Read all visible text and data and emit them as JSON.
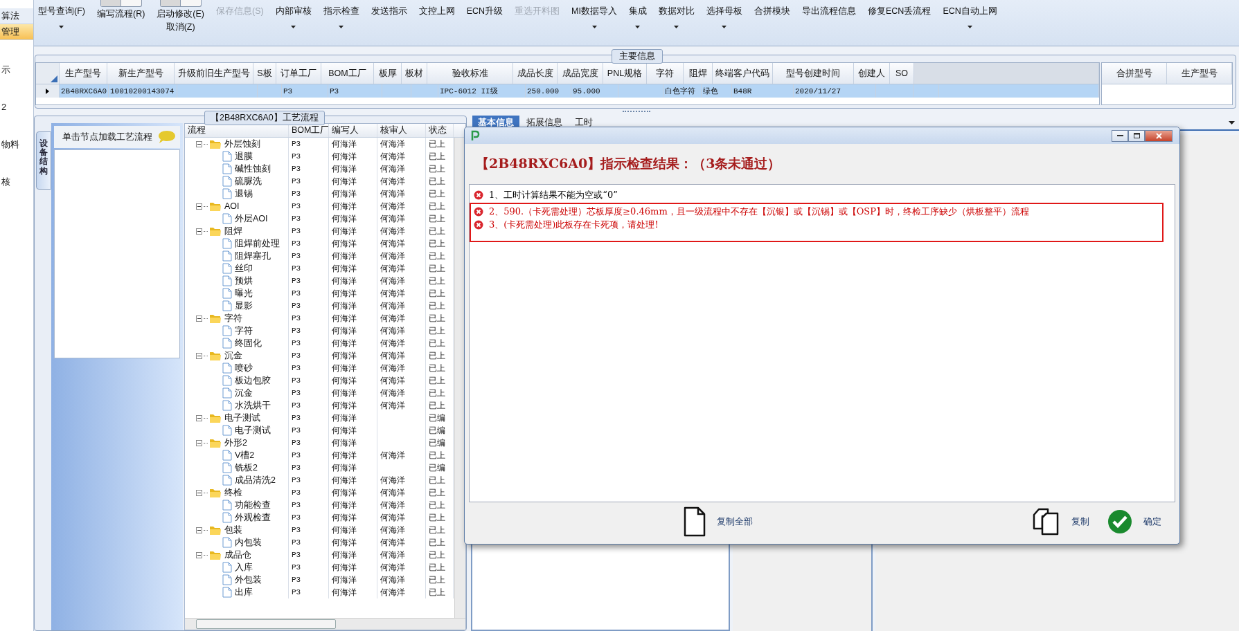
{
  "left_nav": {
    "items": [
      {
        "label": "算法",
        "selected": false
      },
      {
        "label": "管理",
        "selected": true
      },
      {
        "label": "示",
        "selected": false
      },
      {
        "label": "2",
        "selected": false
      },
      {
        "label": "物料",
        "selected": false
      },
      {
        "label": "核",
        "selected": false
      }
    ]
  },
  "toolbar": [
    {
      "kind": "button",
      "lines": [
        "型号查询(F)"
      ],
      "caret": true,
      "disabled": false
    },
    {
      "kind": "toggle",
      "lines": [
        "编写流程(R)"
      ],
      "caret": false,
      "disabled": false,
      "on": false
    },
    {
      "kind": "toggle",
      "lines": [
        "启动修改(E)",
        "取消(Z)"
      ],
      "caret": false,
      "disabled": false,
      "on": false
    },
    {
      "kind": "button",
      "lines": [
        "保存信息(S)"
      ],
      "caret": false,
      "disabled": true
    },
    {
      "kind": "button",
      "lines": [
        "内部审核"
      ],
      "caret": true,
      "disabled": false
    },
    {
      "kind": "button",
      "lines": [
        "指示检查"
      ],
      "caret": true,
      "disabled": false
    },
    {
      "kind": "button",
      "lines": [
        "发送指示"
      ],
      "caret": false,
      "disabled": false
    },
    {
      "kind": "button",
      "lines": [
        "文控上网"
      ],
      "caret": false,
      "disabled": false
    },
    {
      "kind": "button",
      "lines": [
        "ECN升级"
      ],
      "caret": false,
      "disabled": false
    },
    {
      "kind": "button",
      "lines": [
        "重选开料图"
      ],
      "caret": false,
      "disabled": true
    },
    {
      "kind": "button",
      "lines": [
        "MI数据导入"
      ],
      "caret": true,
      "disabled": false
    },
    {
      "kind": "button",
      "lines": [
        "集成"
      ],
      "caret": true,
      "disabled": false
    },
    {
      "kind": "button",
      "lines": [
        "数据对比"
      ],
      "caret": true,
      "disabled": false
    },
    {
      "kind": "button",
      "lines": [
        "选择母板"
      ],
      "caret": true,
      "disabled": false
    },
    {
      "kind": "button",
      "lines": [
        "合拼模块"
      ],
      "caret": false,
      "disabled": false
    },
    {
      "kind": "button",
      "lines": [
        "导出流程信息"
      ],
      "caret": false,
      "disabled": false
    },
    {
      "kind": "button",
      "lines": [
        "修复ECN丢流程"
      ],
      "caret": false,
      "disabled": false
    },
    {
      "kind": "button",
      "lines": [
        "ECN自动上网"
      ],
      "caret": true,
      "disabled": false
    }
  ],
  "main_info": {
    "title": "主要信息",
    "columns": [
      "生产型号",
      "新生产型号",
      "升级前旧生产型号",
      "S板",
      "订单工厂",
      "BOM工厂",
      "板厚",
      "板材",
      "验收标准",
      "成品长度",
      "成品宽度",
      "PNL规格",
      "字符",
      "阻焊",
      "终端客户代码",
      "型号创建时间",
      "创建人",
      "SO"
    ],
    "rows": [
      {
        "selected": true,
        "cells": [
          "2B48RXC6A0",
          "10010200143074",
          null,
          null,
          "P3",
          "P3",
          null,
          null,
          "IPC-6012 II级",
          "250.000",
          "95.000",
          null,
          "白色字符",
          "绿色",
          "B48R",
          "2020/11/27",
          null,
          null
        ]
      }
    ],
    "side_table": {
      "columns": [
        "合拼型号",
        "生产型号"
      ]
    }
  },
  "process": {
    "title": "【2B48RXC6A0】工艺流程",
    "side_tab": "设备结构",
    "hint": "单击节点加载工艺流程",
    "columns": [
      "流程",
      "BOM工厂",
      "编写人",
      "核审人",
      "状态"
    ],
    "tree": [
      {
        "name": "外层蚀刻",
        "bom": "P3",
        "writer": "何海洋",
        "reviewer": "何海洋",
        "status": "已上",
        "expanded": true,
        "children": [
          {
            "name": "退膜",
            "bom": "P3",
            "writer": "何海洋",
            "reviewer": "何海洋",
            "status": "已上"
          },
          {
            "name": "碱性蚀刻",
            "bom": "P3",
            "writer": "何海洋",
            "reviewer": "何海洋",
            "status": "已上"
          },
          {
            "name": "硫脲洗",
            "bom": "P3",
            "writer": "何海洋",
            "reviewer": "何海洋",
            "status": "已上"
          },
          {
            "name": "退锡",
            "bom": "P3",
            "writer": "何海洋",
            "reviewer": "何海洋",
            "status": "已上"
          }
        ]
      },
      {
        "name": "AOI",
        "bom": "P3",
        "writer": "何海洋",
        "reviewer": "何海洋",
        "status": "已上",
        "expanded": true,
        "children": [
          {
            "name": "外层AOI",
            "bom": "P3",
            "writer": "何海洋",
            "reviewer": "何海洋",
            "status": "已上"
          }
        ]
      },
      {
        "name": "阻焊",
        "bom": "P3",
        "writer": "何海洋",
        "reviewer": "何海洋",
        "status": "已上",
        "expanded": true,
        "children": [
          {
            "name": "阻焊前处理",
            "bom": "P3",
            "writer": "何海洋",
            "reviewer": "何海洋",
            "status": "已上"
          },
          {
            "name": "阻焊塞孔",
            "bom": "P3",
            "writer": "何海洋",
            "reviewer": "何海洋",
            "status": "已上"
          },
          {
            "name": "丝印",
            "bom": "P3",
            "writer": "何海洋",
            "reviewer": "何海洋",
            "status": "已上"
          },
          {
            "name": "预烘",
            "bom": "P3",
            "writer": "何海洋",
            "reviewer": "何海洋",
            "status": "已上"
          },
          {
            "name": "曝光",
            "bom": "P3",
            "writer": "何海洋",
            "reviewer": "何海洋",
            "status": "已上"
          },
          {
            "name": "显影",
            "bom": "P3",
            "writer": "何海洋",
            "reviewer": "何海洋",
            "status": "已上"
          }
        ]
      },
      {
        "name": "字符",
        "bom": "P3",
        "writer": "何海洋",
        "reviewer": "何海洋",
        "status": "已上",
        "expanded": true,
        "children": [
          {
            "name": "字符",
            "bom": "P3",
            "writer": "何海洋",
            "reviewer": "何海洋",
            "status": "已上"
          },
          {
            "name": "终固化",
            "bom": "P3",
            "writer": "何海洋",
            "reviewer": "何海洋",
            "status": "已上"
          }
        ]
      },
      {
        "name": "沉金",
        "bom": "P3",
        "writer": "何海洋",
        "reviewer": "何海洋",
        "status": "已上",
        "expanded": true,
        "children": [
          {
            "name": "喷砂",
            "bom": "P3",
            "writer": "何海洋",
            "reviewer": "何海洋",
            "status": "已上"
          },
          {
            "name": "板边包胶",
            "bom": "P3",
            "writer": "何海洋",
            "reviewer": "何海洋",
            "status": "已上"
          },
          {
            "name": "沉金",
            "bom": "P3",
            "writer": "何海洋",
            "reviewer": "何海洋",
            "status": "已上"
          },
          {
            "name": "水洗烘干",
            "bom": "P3",
            "writer": "何海洋",
            "reviewer": "何海洋",
            "status": "已上"
          }
        ]
      },
      {
        "name": "电子测试",
        "bom": "P3",
        "writer": "何海洋",
        "status": "已编",
        "expanded": true,
        "children": [
          {
            "name": "电子测试",
            "bom": "P3",
            "writer": "何海洋",
            "status": "已编"
          }
        ]
      },
      {
        "name": "外形2",
        "bom": "P3",
        "writer": "何海洋",
        "status": "已编",
        "expanded": true,
        "children": [
          {
            "name": "V槽2",
            "bom": "P3",
            "writer": "何海洋",
            "reviewer": "何海洋",
            "status": "已上"
          },
          {
            "name": "铣板2",
            "bom": "P3",
            "writer": "何海洋",
            "status": "已编"
          },
          {
            "name": "成品清洗2",
            "bom": "P3",
            "writer": "何海洋",
            "reviewer": "何海洋",
            "status": "已上"
          }
        ]
      },
      {
        "name": "终检",
        "bom": "P3",
        "writer": "何海洋",
        "reviewer": "何海洋",
        "status": "已上",
        "expanded": true,
        "children": [
          {
            "name": "功能检查",
            "bom": "P3",
            "writer": "何海洋",
            "reviewer": "何海洋",
            "status": "已上"
          },
          {
            "name": "外观检查",
            "bom": "P3",
            "writer": "何海洋",
            "reviewer": "何海洋",
            "status": "已上"
          }
        ]
      },
      {
        "name": "包装",
        "bom": "P3",
        "writer": "何海洋",
        "reviewer": "何海洋",
        "status": "已上",
        "expanded": true,
        "children": [
          {
            "name": "内包装",
            "bom": "P3",
            "writer": "何海洋",
            "reviewer": "何海洋",
            "status": "已上"
          }
        ]
      },
      {
        "name": "成品仓",
        "bom": "P3",
        "writer": "何海洋",
        "reviewer": "何海洋",
        "status": "已上",
        "expanded": true,
        "children": [
          {
            "name": "入库",
            "bom": "P3",
            "writer": "何海洋",
            "reviewer": "何海洋",
            "status": "已上"
          },
          {
            "name": "外包装",
            "bom": "P3",
            "writer": "何海洋",
            "reviewer": "何海洋",
            "status": "已上"
          },
          {
            "name": "出库",
            "bom": "P3",
            "writer": "何海洋",
            "reviewer": "何海洋",
            "status": "已上"
          }
        ]
      }
    ]
  },
  "detail_tabs": [
    {
      "label": "基本信息",
      "selected": true
    },
    {
      "label": "拓展信息",
      "selected": false
    },
    {
      "label": "工时",
      "selected": false
    }
  ],
  "dialog": {
    "heading": "【2B48RXC6A0】指示检查结果：（3条未通过）",
    "message_groups": [
      {
        "framed": false,
        "messages": [
          {
            "text": "1、工时计算结果不能为空或“0”",
            "color": "#000000"
          }
        ]
      },
      {
        "framed": true,
        "messages": [
          {
            "text": "2、590.（卡死需处理）芯板厚度≥0.46mm，且一级流程中不存在【沉银】或【沉锡】或【OSP】时，终检工序缺少（烘板整平）流程",
            "color": "#cc0000"
          },
          {
            "text": "3、(卡死需处理)此板存在卡死项，请处理!",
            "color": "#cc0000"
          }
        ]
      }
    ],
    "buttons": [
      {
        "kind": "copy_all",
        "label": "复制全部"
      },
      {
        "kind": "copy",
        "label": "复制"
      },
      {
        "kind": "ok",
        "label": "确定"
      }
    ]
  }
}
